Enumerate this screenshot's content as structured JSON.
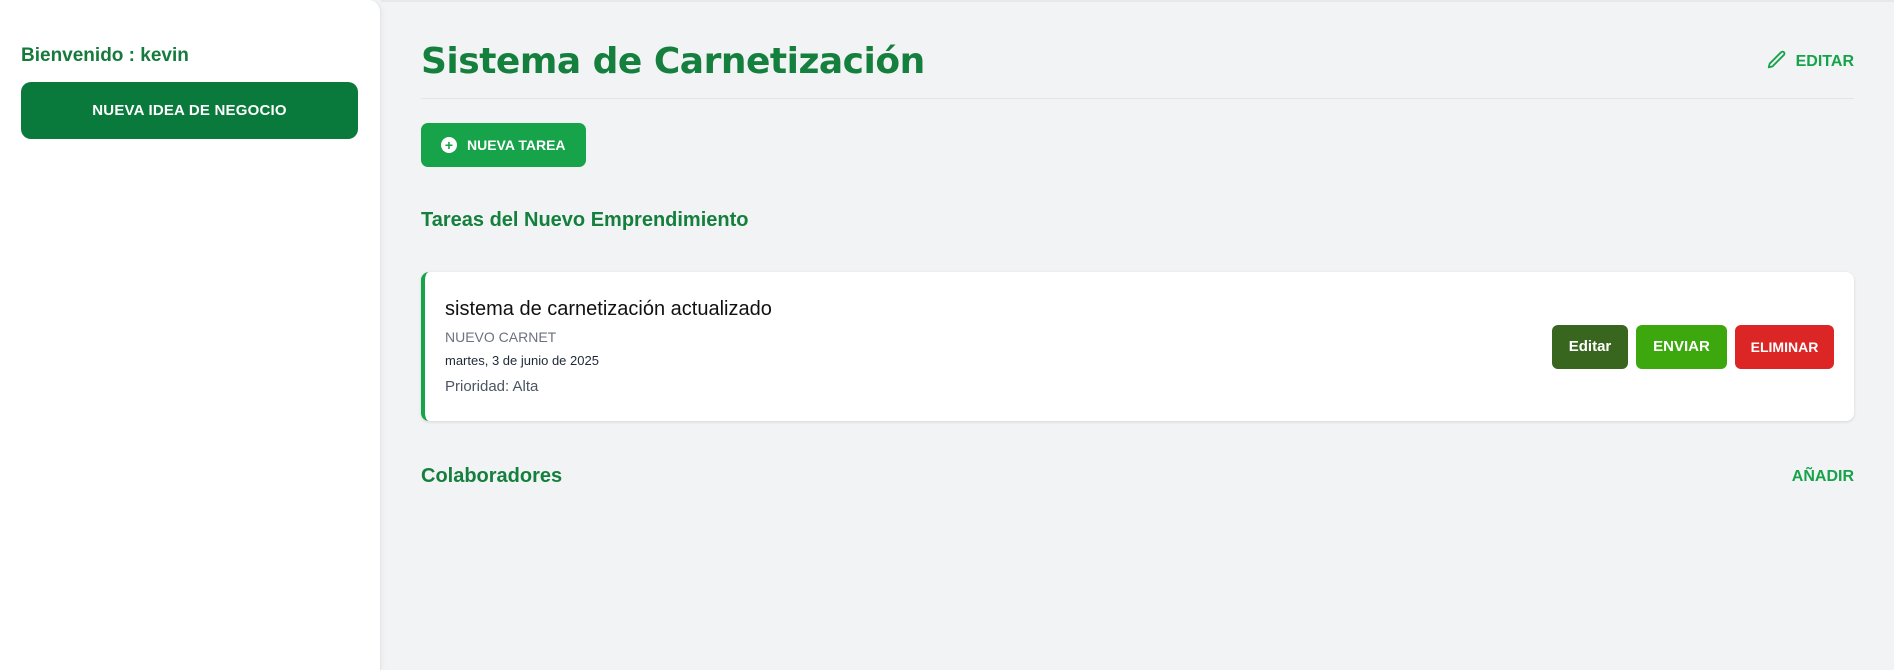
{
  "sidebar": {
    "welcome": "Bienvenido : kevin",
    "new_idea_label": "NUEVA IDEA DE NEGOCIO"
  },
  "header": {
    "title": "Sistema de Carnetización",
    "edit_label": "EDITAR",
    "edit_icon": "pencil-icon"
  },
  "toolbar": {
    "new_task_label": "NUEVA TAREA",
    "new_task_icon": "plus-circle-icon"
  },
  "tasks_section": {
    "title": "Tareas del Nuevo Emprendimiento",
    "tasks": [
      {
        "title": "sistema de carnetización actualizado",
        "category": "NUEVO CARNET",
        "date": "martes, 3 de junio de 2025",
        "priority": "Prioridad: Alta",
        "edit_label": "Editar",
        "send_label": "ENVIAR",
        "delete_label": "ELIMINAR"
      }
    ]
  },
  "collaborators": {
    "title": "Colaboradores",
    "add_label": "AÑADIR"
  },
  "colors": {
    "brand_dark": "#0a7a3c",
    "brand": "#16a34a",
    "title_green": "#15803d",
    "edit_btn": "#38661f",
    "send_btn": "#3ca80e",
    "delete_btn": "#dc2626"
  }
}
